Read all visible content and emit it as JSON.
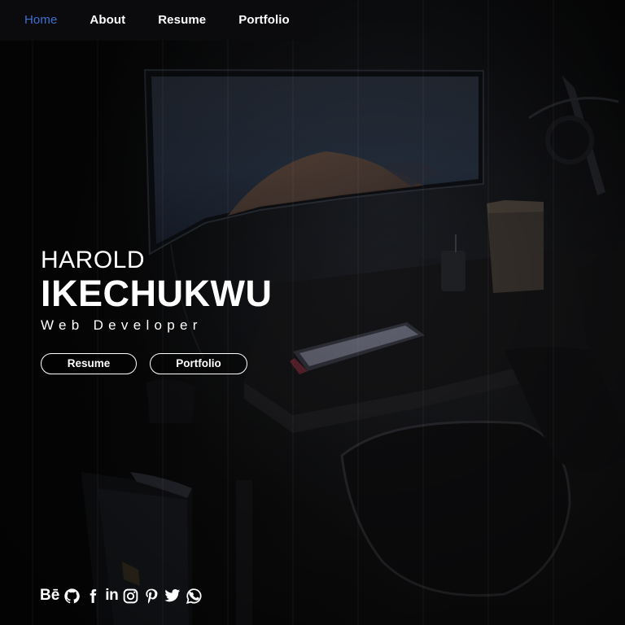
{
  "nav": {
    "items": [
      {
        "label": "Home",
        "active": true
      },
      {
        "label": "About",
        "active": false
      },
      {
        "label": "Resume",
        "active": false
      },
      {
        "label": "Portfolio",
        "active": false
      }
    ],
    "active_color": "#3f6fd1"
  },
  "hero": {
    "first_name": "HAROLD",
    "last_name": "IKECHUKWU",
    "role": "Web Developer",
    "buttons": {
      "resume": "Resume",
      "portfolio": "Portfolio"
    }
  },
  "social": {
    "icons": [
      "behance-icon",
      "github-icon",
      "facebook-icon",
      "linkedin-icon",
      "instagram-icon",
      "pinterest-icon",
      "twitter-icon",
      "whatsapp-icon"
    ]
  },
  "background": {
    "description_icon": "desk-setup-photo",
    "base_color": "#070707"
  }
}
